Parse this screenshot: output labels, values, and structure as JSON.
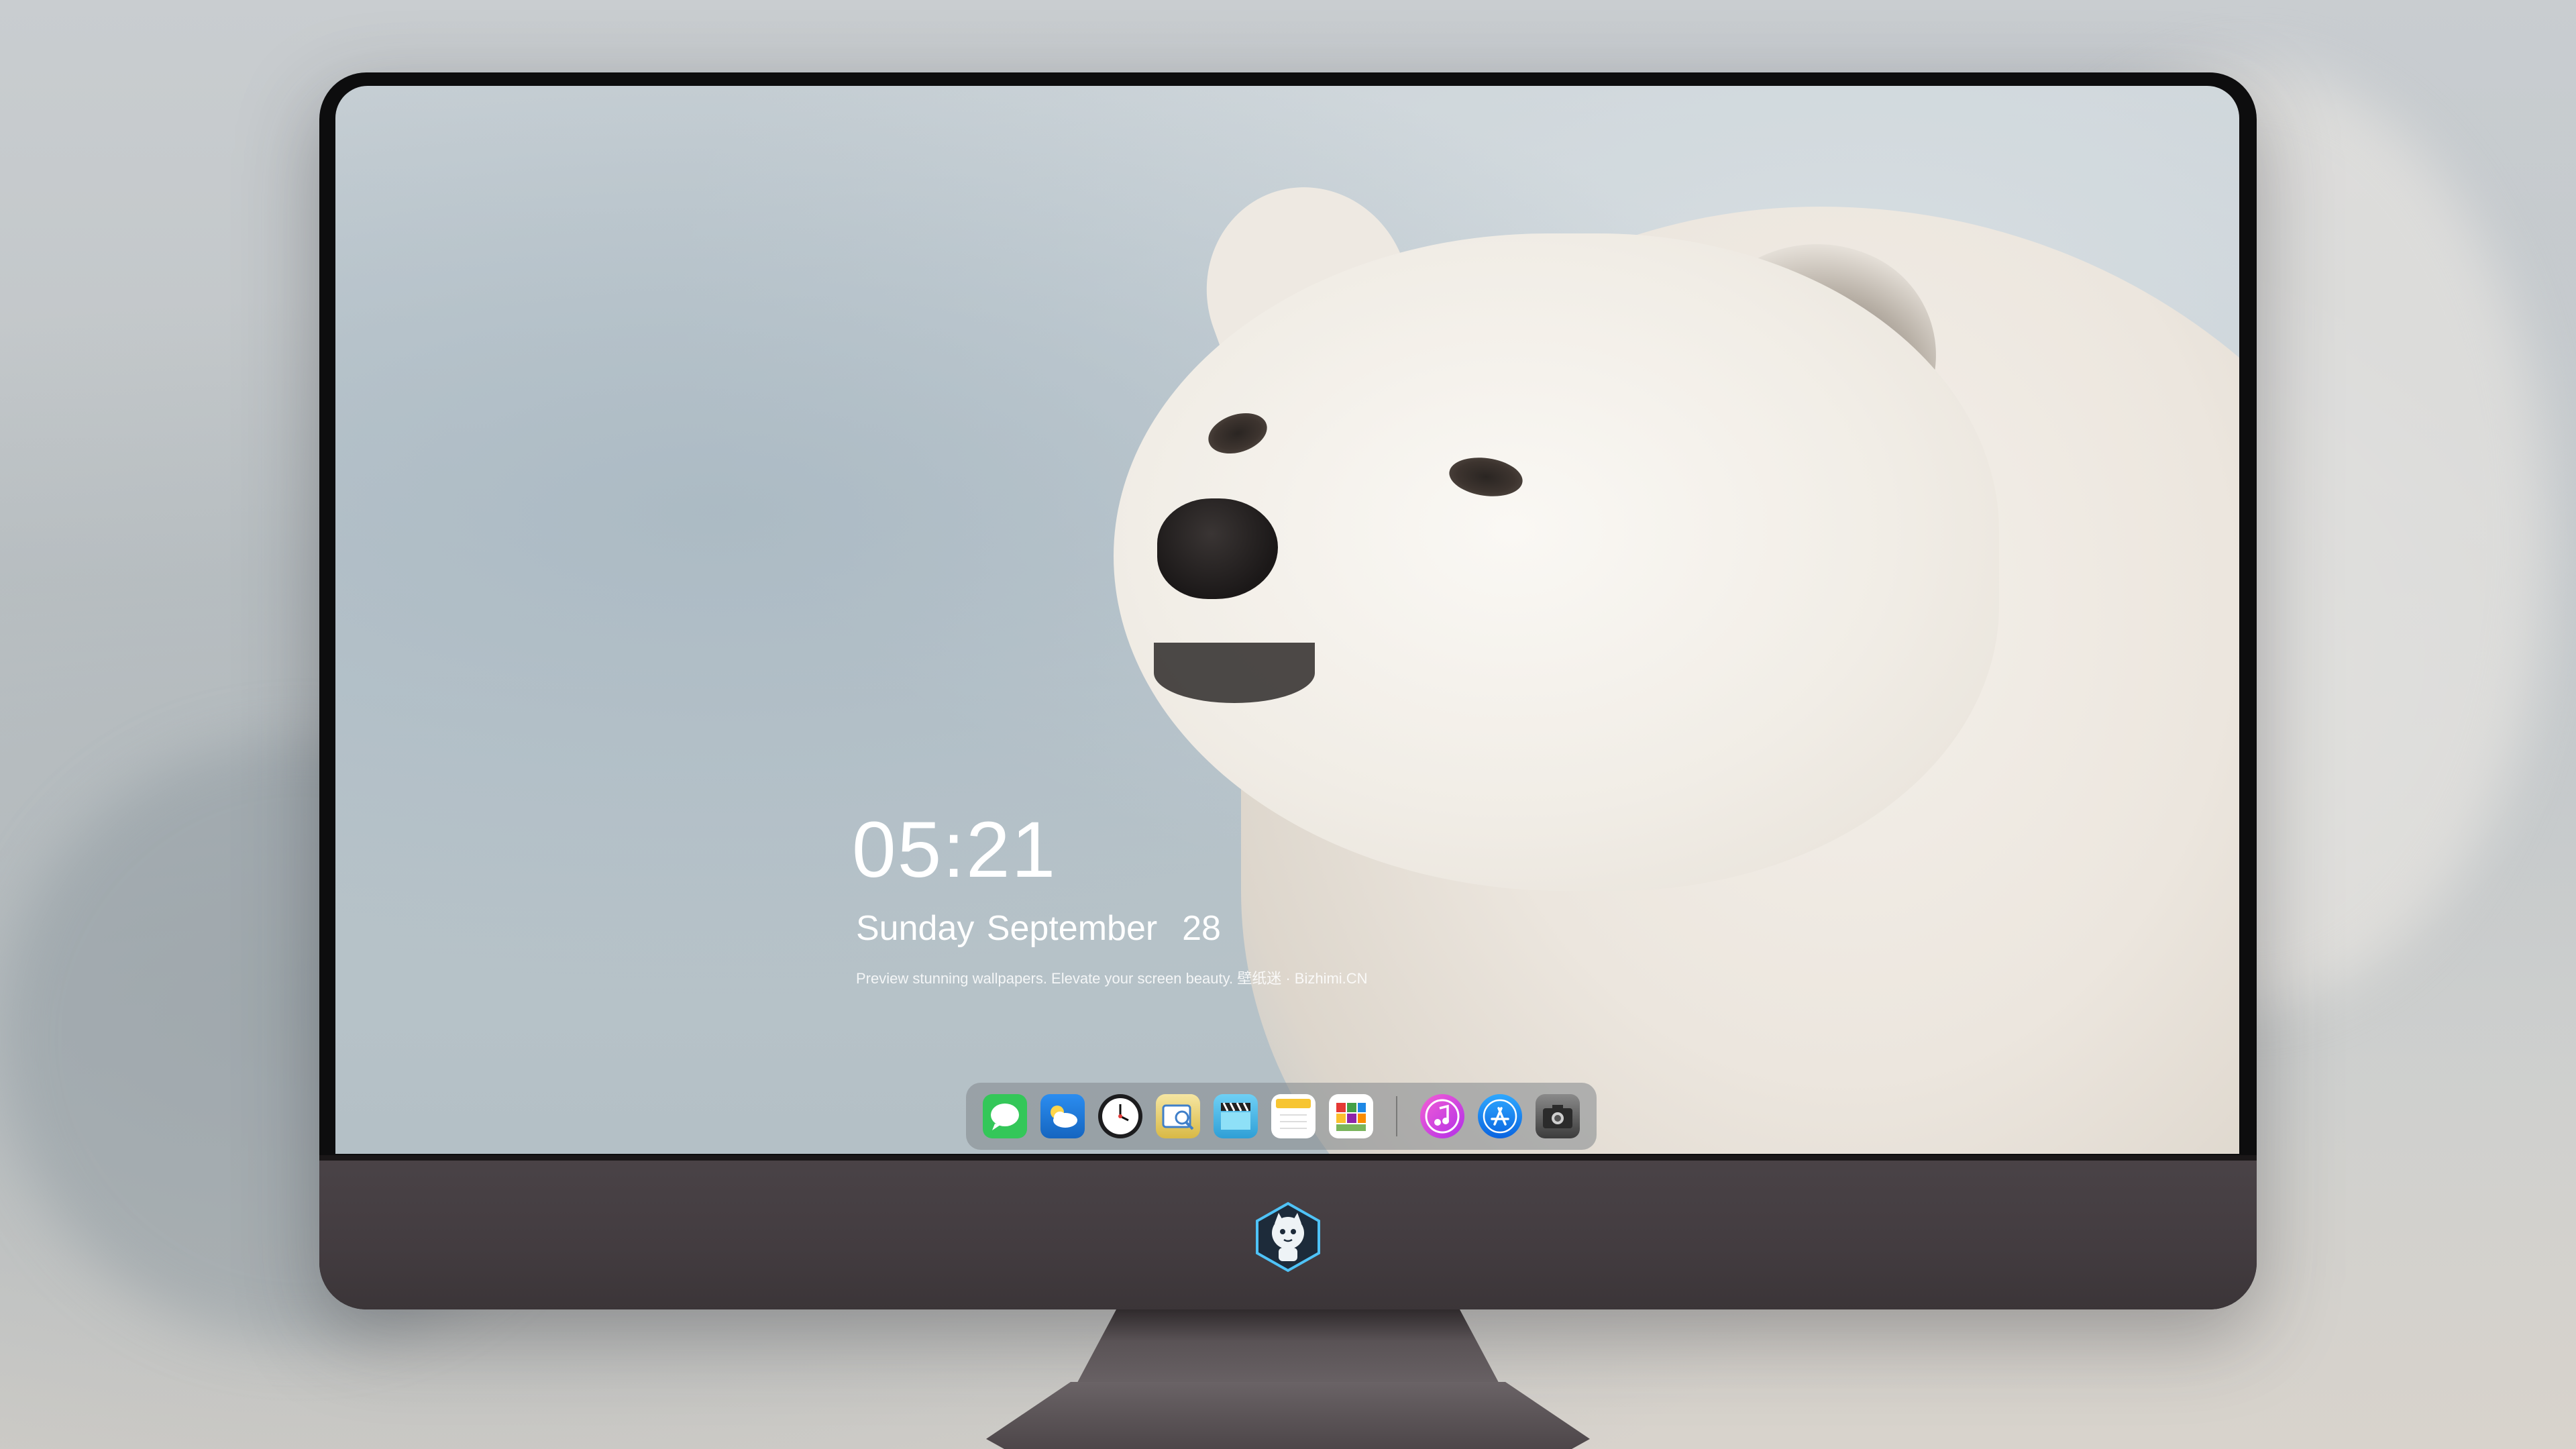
{
  "lockscreen": {
    "time": "05:21",
    "date": "Sunday September  28",
    "tagline": "Preview stunning wallpapers. Elevate your screen beauty. 壁纸迷 · Bizhimi.CN"
  },
  "wallpaper": {
    "subject": "arctic fox"
  },
  "dock": {
    "apps": [
      {
        "name": "messages-icon",
        "color": "#34c759"
      },
      {
        "name": "weather-icon",
        "color": "#1e88e5"
      },
      {
        "name": "clock-icon",
        "color": "#1c1c1e"
      },
      {
        "name": "preview-icon",
        "color": "#e8c547"
      },
      {
        "name": "video-icon",
        "color": "#4fb8e6"
      },
      {
        "name": "notes-icon",
        "color": "#f7d24a"
      },
      {
        "name": "calendar-icon",
        "color": "#7ab55c"
      },
      {
        "name": "itunes-icon",
        "color": "#e24ad8"
      },
      {
        "name": "app-store-icon",
        "color": "#1a8cff"
      },
      {
        "name": "screenshot-icon",
        "color": "#4a4a4a"
      }
    ]
  },
  "colors": {
    "chin": "#453e42",
    "bezel": "#0d0d0e"
  }
}
